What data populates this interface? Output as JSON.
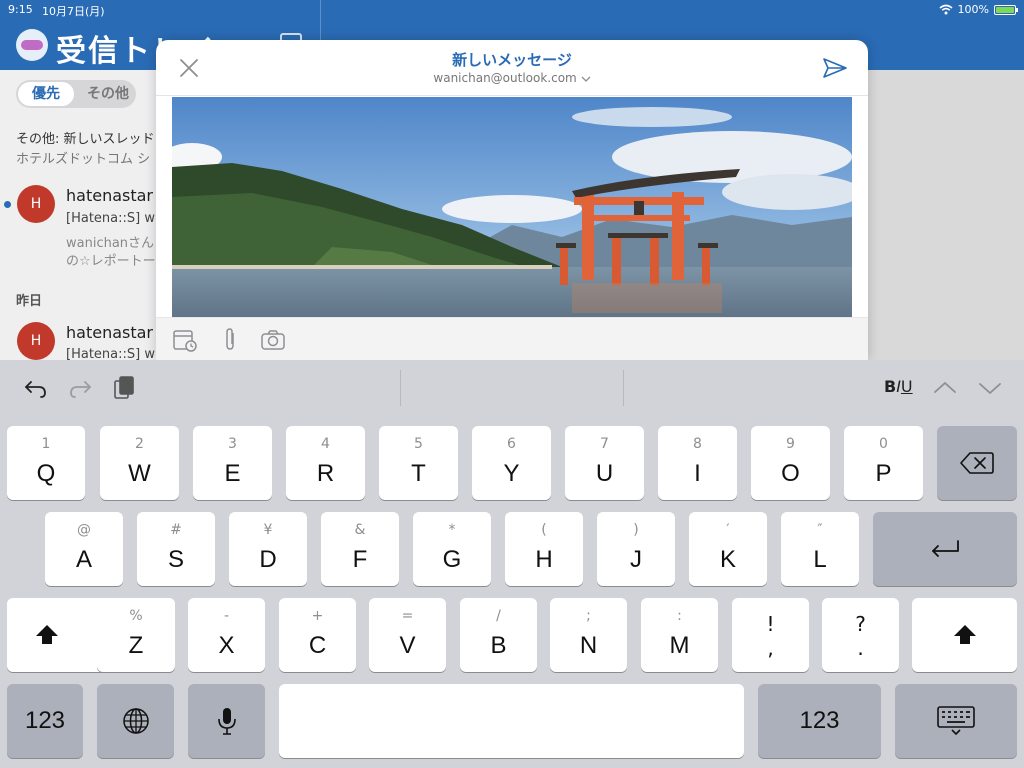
{
  "status_bar": {
    "time": "9:15",
    "date": "10月7日(月)",
    "battery": "100%"
  },
  "inbox": {
    "title": "受信トレイ",
    "tabs": [
      "優先",
      "その他"
    ],
    "other_notice": "その他: 新しいスレッド",
    "other_notice_sub": "ホテルズドットコム シ",
    "mails": [
      {
        "avatar": "H",
        "sender": "hatenastar",
        "subject": "[Hatena::S] w",
        "preview1": "wanichanさん",
        "preview2": "の☆レポートー"
      },
      {
        "avatar": "H",
        "sender": "hatenastar",
        "subject": "[Hatena::S] w"
      }
    ],
    "section_yesterday": "昨日"
  },
  "compose": {
    "title": "新しいメッセージ",
    "from": "wanichan@outlook.com"
  },
  "keyboard": {
    "format": {
      "bold": "B",
      "italic": "I",
      "underline": "U"
    },
    "row1": [
      {
        "sub": "1",
        "main": "Q"
      },
      {
        "sub": "2",
        "main": "W"
      },
      {
        "sub": "3",
        "main": "E"
      },
      {
        "sub": "4",
        "main": "R"
      },
      {
        "sub": "5",
        "main": "T"
      },
      {
        "sub": "6",
        "main": "Y"
      },
      {
        "sub": "7",
        "main": "U"
      },
      {
        "sub": "8",
        "main": "I"
      },
      {
        "sub": "9",
        "main": "O"
      },
      {
        "sub": "0",
        "main": "P"
      }
    ],
    "row2": [
      {
        "sub": "@",
        "main": "A"
      },
      {
        "sub": "#",
        "main": "S"
      },
      {
        "sub": "¥",
        "main": "D"
      },
      {
        "sub": "&",
        "main": "F"
      },
      {
        "sub": "*",
        "main": "G"
      },
      {
        "sub": "(",
        "main": "H"
      },
      {
        "sub": ")",
        "main": "J"
      },
      {
        "sub": "′",
        "main": "K"
      },
      {
        "sub": "″",
        "main": "L"
      }
    ],
    "row3": [
      {
        "sub": "%",
        "main": "Z"
      },
      {
        "sub": "-",
        "main": "X"
      },
      {
        "sub": "+",
        "main": "C"
      },
      {
        "sub": "=",
        "main": "V"
      },
      {
        "sub": "/",
        "main": "B"
      },
      {
        "sub": ";",
        "main": "N"
      },
      {
        "sub": ":",
        "main": "M"
      }
    ],
    "exclaim_key": {
      "top": "!",
      "bottom": ","
    },
    "question_key": {
      "top": "?",
      "bottom": "."
    },
    "numbers_label": "123"
  }
}
